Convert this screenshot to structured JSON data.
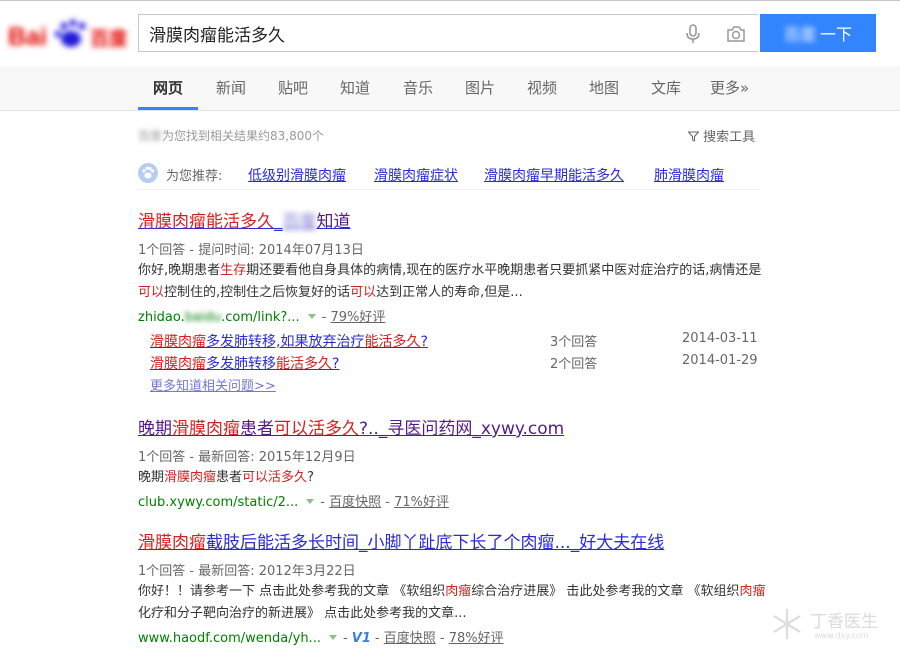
{
  "header": {
    "search_query": "滑膜肉瘤能活多久",
    "search_button_label": "一下",
    "search_button_blurred": "百度",
    "logo_text": "Bai百度"
  },
  "nav": {
    "tabs": [
      {
        "label": "网页",
        "active": true
      },
      {
        "label": "新闻"
      },
      {
        "label": "贴吧"
      },
      {
        "label": "知道"
      },
      {
        "label": "音乐"
      },
      {
        "label": "图片"
      },
      {
        "label": "视频"
      },
      {
        "label": "地图"
      },
      {
        "label": "文库"
      },
      {
        "label": "更多»"
      }
    ]
  },
  "stats": {
    "blurred_prefix": "百度",
    "text": "为您找到相关结果约83,800个",
    "tools_label": "搜索工具"
  },
  "recommend": {
    "label": "为您推荐:",
    "links": [
      "低级别滑膜肉瘤",
      "滑膜肉瘤症状",
      "滑膜肉瘤早期能活多久",
      "肺滑膜肉瘤"
    ]
  },
  "results": [
    {
      "title_hl": "滑膜肉瘤能活多久",
      "title_mid": "_",
      "title_blur": "百度",
      "title_tail": "知道",
      "meta": "1个回答 - 提问时间: 2014年07月13日",
      "abstract": {
        "p1": "你好,晚期患者",
        "h1": "生存",
        "p2": "期还要看他自身具体的病情,现在的医疗水平晚期患者只要抓紧中医对症治疗的话,病情还是",
        "h2": "可以",
        "p3": "控制住的,控制住之后恢复好的话",
        "h3": "可以",
        "p4": "达到正常人的寿命,但是..."
      },
      "url_prefix": "zhidao.",
      "url_blur": "baidu",
      "url_suffix": ".com/link?...",
      "rating": "79%好评",
      "sub_results": [
        {
          "hl1": "滑膜肉瘤",
          "mid": "多发肺转移,如果放弃治疗",
          "hl2": "能活多久",
          "tail": "?",
          "count": "3个回答",
          "date": "2014-03-11"
        },
        {
          "hl1": "滑膜肉瘤",
          "mid": "多发肺转移",
          "hl2": "能活多久",
          "tail": "?",
          "count": "2个回答",
          "date": "2014-01-29"
        }
      ],
      "more_label": "更多知道相关问题>>"
    },
    {
      "title_p1": "晚期",
      "title_h1": "滑膜肉瘤",
      "title_p2": "患者",
      "title_h2": "可以活多久",
      "title_p3": "?.._寻医问药网_xywy.com",
      "meta": "1个回答 - 最新回答: 2015年12月9日",
      "abstract": {
        "p1": "晚期",
        "h1": "滑膜肉瘤",
        "p2": "患者",
        "h2": "可以活多久",
        "p3": "?"
      },
      "url": "club.xywy.com/static/2...",
      "snapshot": "百度快照",
      "rating": "71%好评"
    },
    {
      "title_h1": "滑膜肉瘤",
      "title_p1": "截肢后能活多长时间_小脚丫趾底下长了个肉瘤..._好大夫在线",
      "meta": "1个回答 - 最新回答: 2012年3月22日",
      "abstract": {
        "p1": "你好！！请参考一下 点击此处参考我的文章 《软组织",
        "h1": "肉瘤",
        "p2": "综合治疗进展》 击此处参考我的文章 《软组织",
        "h2": "肉瘤",
        "p3": "化疗和分子靶向治疗的新进展》 点击此处参考我的文章..."
      },
      "url": "www.haodf.com/wenda/yh...",
      "badge": "V1",
      "snapshot": "百度快照",
      "rating": "78%好评"
    }
  ],
  "watermark": {
    "text": "丁香医生",
    "url": "www.dxy.com"
  },
  "colors": {
    "accent": "#3385ff",
    "link": "#2a2ad9",
    "visited": "#551a8b",
    "highlight": "#d62020",
    "url_green": "#008000"
  }
}
